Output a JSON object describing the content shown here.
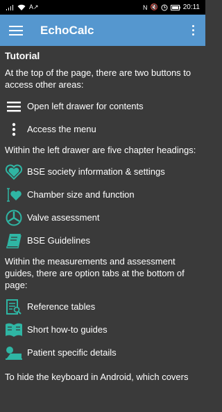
{
  "status": {
    "time": "20:11",
    "battery": ""
  },
  "appbar": {
    "title": "EchoCalc"
  },
  "tutorial": {
    "heading": "Tutorial",
    "intro": "At the top of the page, there are two buttons to access other areas:",
    "top_buttons": [
      "Open left drawer for contents",
      "Access the menu"
    ],
    "drawer_intro": "Within the left drawer are five chapter headings:",
    "chapters": [
      "BSE society information & settings",
      "Chamber size and function",
      "Valve assessment",
      "BSE Guidelines"
    ],
    "tabs_intro": "Within the measurements and assessment guides, there are option tabs at the bottom of page:",
    "tabs": [
      "Reference tables",
      "Short how-to guides",
      "Patient specific details"
    ],
    "keyboard_note": "To hide the keyboard in Android, which covers"
  },
  "colors": {
    "appbar": "#5597cf",
    "accent": "#2fb6a4",
    "background": "#3a3a3a"
  }
}
